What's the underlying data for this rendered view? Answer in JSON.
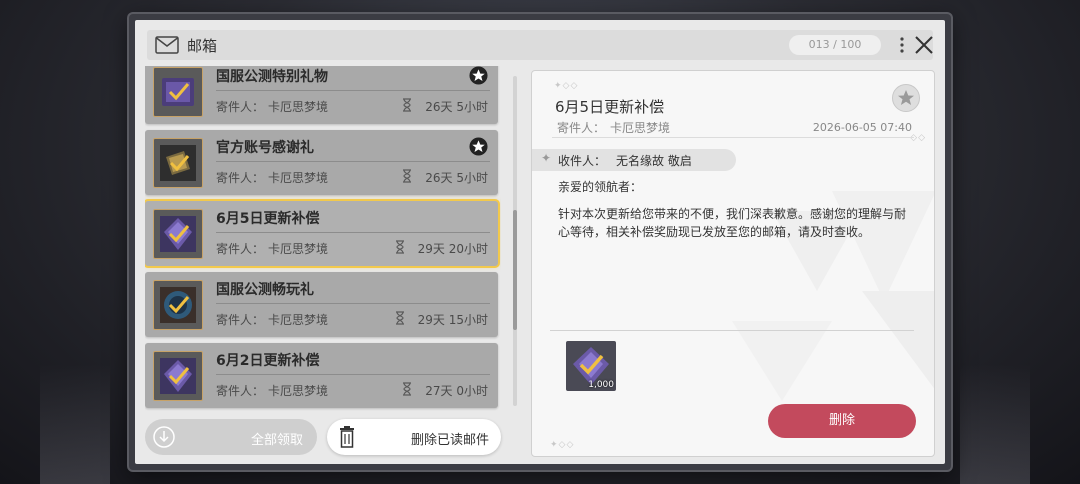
{
  "header": {
    "title": "邮箱",
    "counter": "013 / 100"
  },
  "mail_list": [
    {
      "title": "国服公测特别礼物",
      "sender_label": "寄件人：",
      "sender": "卡厄思梦境",
      "time_left": "26天 5小时",
      "starred": true
    },
    {
      "title": "官方账号感谢礼",
      "sender_label": "寄件人：",
      "sender": "卡厄思梦境",
      "time_left": "26天 5小时",
      "starred": true
    },
    {
      "title": "6月5日更新补偿",
      "sender_label": "寄件人：",
      "sender": "卡厄思梦境",
      "time_left": "29天 20小时",
      "selected": true
    },
    {
      "title": "国服公测畅玩礼",
      "sender_label": "寄件人：",
      "sender": "卡厄思梦境",
      "time_left": "29天 15小时"
    },
    {
      "title": "6月2日更新补偿",
      "sender_label": "寄件人：",
      "sender": "卡厄思梦境",
      "time_left": "27天 0小时"
    }
  ],
  "buttons": {
    "claim_all": "全部领取",
    "delete_read": "删除已读邮件",
    "delete": "删除"
  },
  "detail": {
    "title": "6月5日更新补偿",
    "sender_label": "寄件人：",
    "sender": "卡厄思梦境",
    "date": "2026-06-05 07:40",
    "recipient_label": "收件人：",
    "recipient": "无名缘故 敬启",
    "greeting": "亲爱的领航者：",
    "body": "针对本次更新给您带来的不便，我们深表歉意。感谢您的理解与耐心等待，相关补偿奖励现已发放至您的邮箱，请及时查收。",
    "reward_qty": "1,000"
  },
  "colors": {
    "accent_selected": "#f2c94c",
    "delete_button": "#c34a5d"
  },
  "list_scroll_fraction": 0.64
}
